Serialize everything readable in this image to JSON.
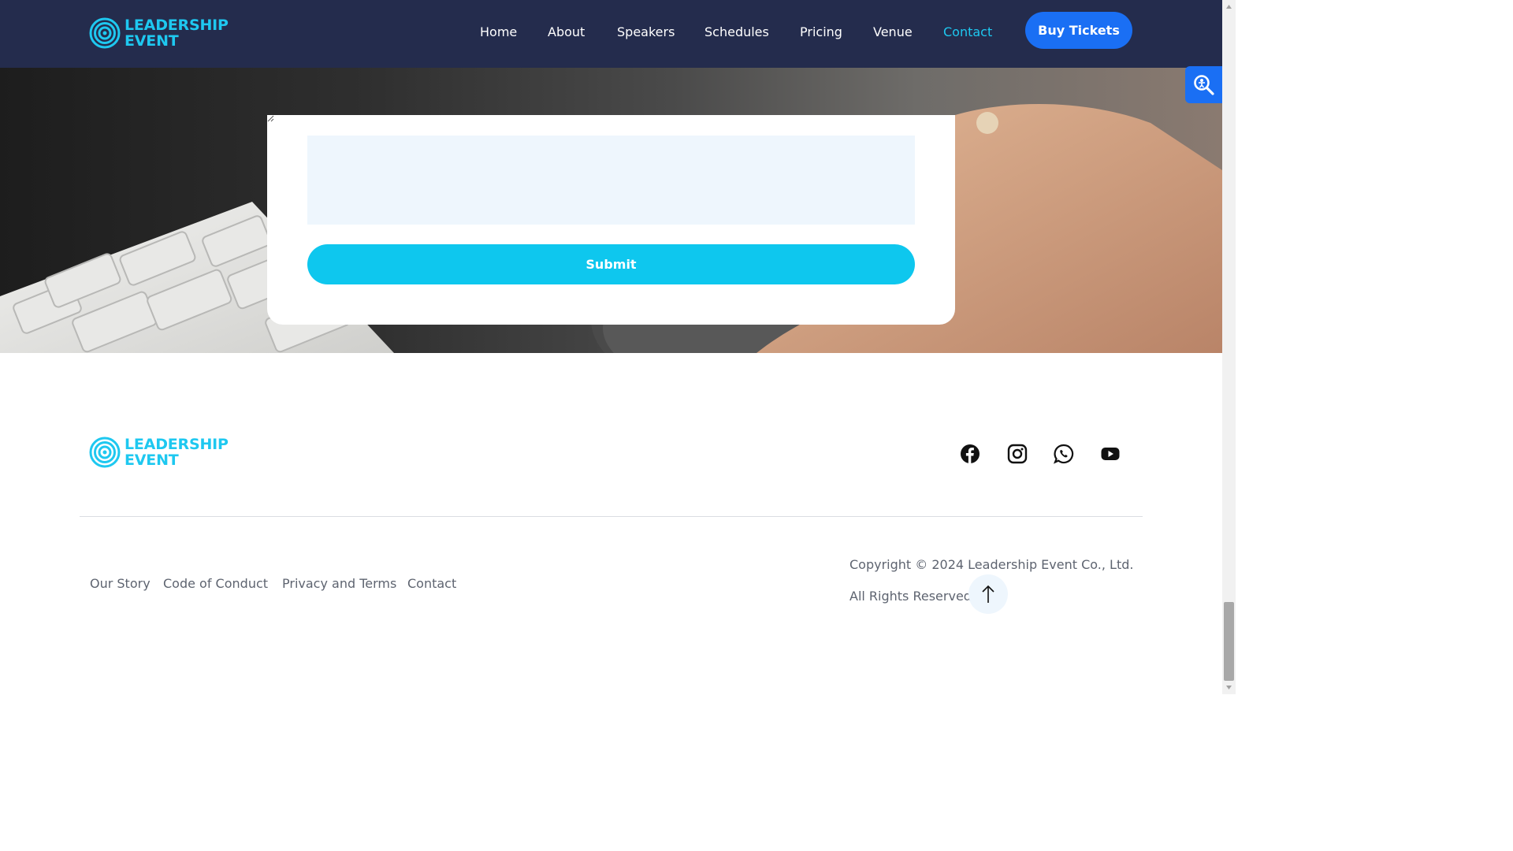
{
  "brand": {
    "line1": "LEADERSHIP",
    "line2": "EVENT",
    "color": "#1ec8f0"
  },
  "nav": {
    "items": [
      {
        "label": "Home",
        "active": false
      },
      {
        "label": "About",
        "active": false
      },
      {
        "label": "Speakers",
        "active": false
      },
      {
        "label": "Schedules",
        "active": false
      },
      {
        "label": "Pricing",
        "active": false
      },
      {
        "label": "Venue",
        "active": false
      },
      {
        "label": "Contact",
        "active": true
      }
    ],
    "cta": "Buy Tickets"
  },
  "form": {
    "message_value": "",
    "submit_label": "Submit"
  },
  "accessibility": {
    "icon": "accessibility-search-icon"
  },
  "footer": {
    "social": [
      {
        "name": "facebook-icon"
      },
      {
        "name": "instagram-icon"
      },
      {
        "name": "whatsapp-icon"
      },
      {
        "name": "youtube-icon"
      }
    ],
    "links": [
      "Our Story",
      "Code of Conduct",
      "Privacy and Terms",
      "Contact"
    ],
    "copyright": "Copyright © 2024 Leadership Event Co., Ltd.",
    "rights": "All Rights Reserved."
  },
  "colors": {
    "header_bg": "#242c4d",
    "accent": "#1ec8f0",
    "button_blue": "#1a6ff4",
    "submit_cyan": "#0ec7ee"
  }
}
